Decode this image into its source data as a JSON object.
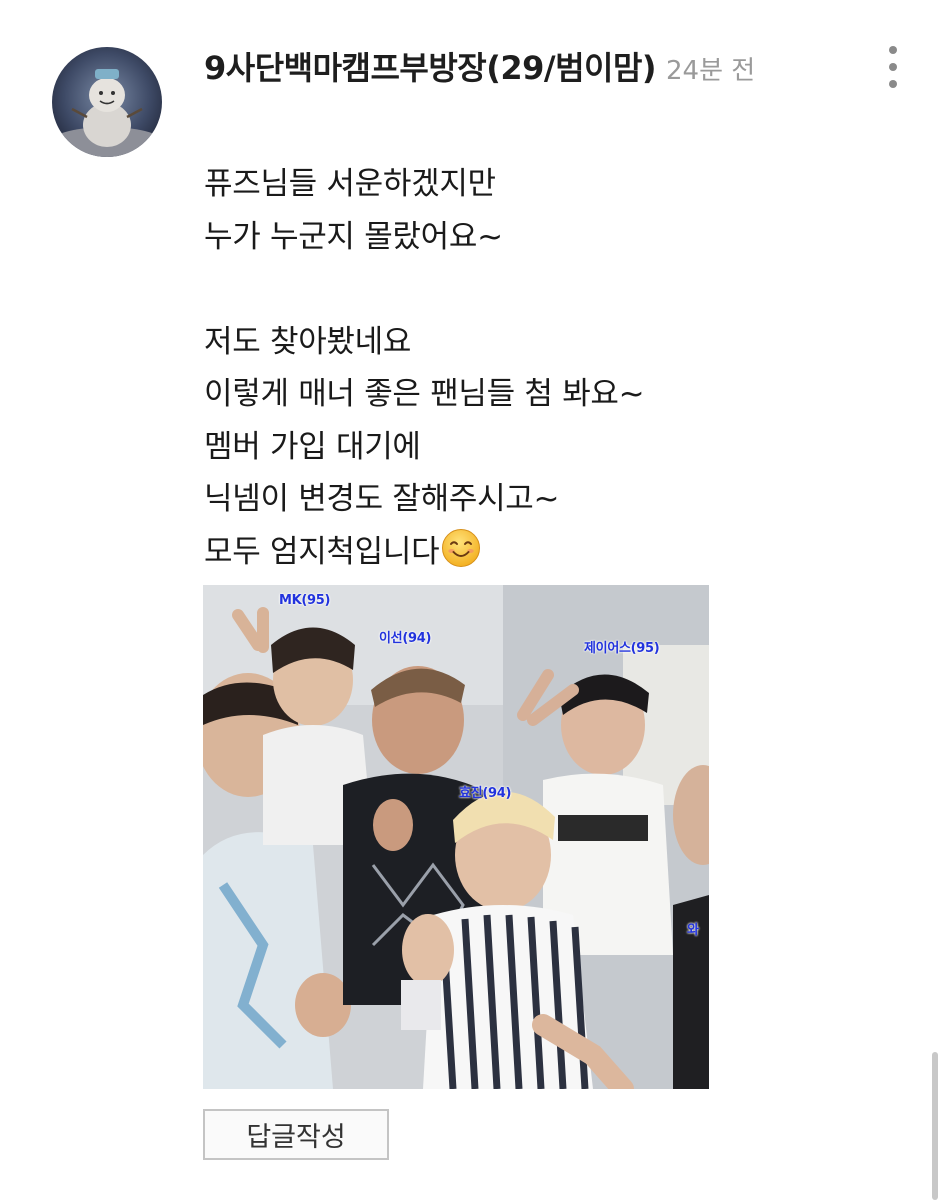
{
  "comment": {
    "author": "9사단백마캠프부방장(29/범이맘)",
    "time": "24분 전",
    "avatar_icon": "snowman-avatar-icon",
    "more_icon": "more-vertical-icon",
    "body_lines": [
      "퓨즈님들 서운하겠지만",
      "누가 누군지 몰랐어요~",
      "",
      "저도 찾아봤네요",
      "이렇게 매너 좋은 팬님들 첨 봐요~",
      "멤버 가입 대기에",
      "닉넴이 변경도 잘해주시고~",
      "모두 엄지척입니다"
    ],
    "body_emoji": "smiling-face-icon",
    "photo": {
      "labels": [
        "MK(95)",
        "이선(94)",
        "제이어스(95)",
        "효진(94)",
        "와"
      ]
    },
    "reply_button": "답글작성"
  },
  "colors": {
    "author": "#1e1e1e",
    "time": "#9a9a9a",
    "body": "#1a1a1a",
    "label": "#2233dd",
    "button_border": "#c4c4c4"
  }
}
